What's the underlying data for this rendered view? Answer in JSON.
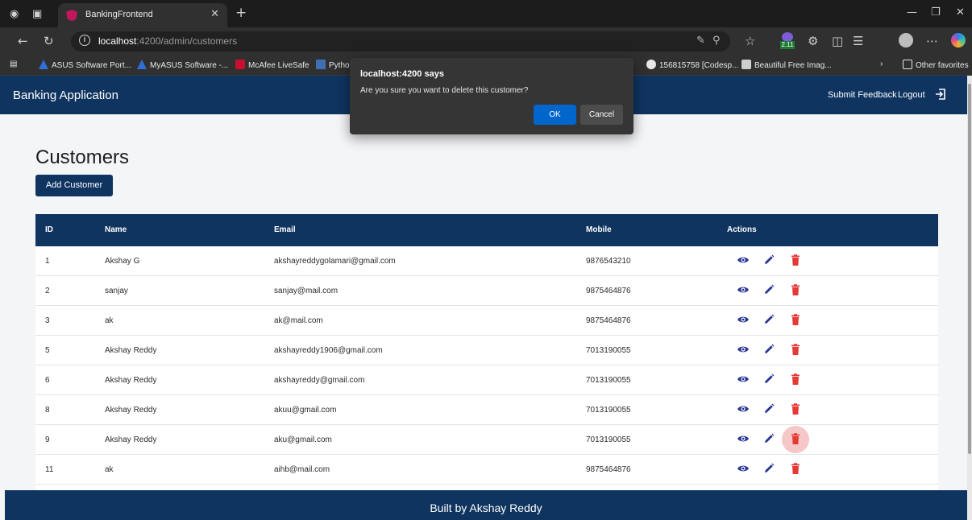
{
  "browser": {
    "tab_title": "BankingFrontend",
    "url_host": "localhost",
    "url_path": ":4200/admin/customers",
    "bookmarks": [
      "ASUS Software Port...",
      "MyASUS Software -...",
      "McAfee LiveSafe",
      "Python",
      "156815758 [Codesp...",
      "Beautiful Free Imag..."
    ],
    "other_favorites": "Other favorites",
    "extension_badge": "2.11"
  },
  "navbar": {
    "brand": "Banking Application",
    "feedback": "Submit Feedback",
    "logout": "Logout"
  },
  "main": {
    "title": "Customers",
    "add_button": "Add Customer"
  },
  "table": {
    "headers": [
      "ID",
      "Name",
      "Email",
      "Mobile",
      "Actions"
    ],
    "rows": [
      {
        "id": "1",
        "name": "Akshay G",
        "email": "akshayreddygolamari@gmail.com",
        "mobile": "9876543210"
      },
      {
        "id": "2",
        "name": "sanjay",
        "email": "sanjay@mail.com",
        "mobile": "9875464876"
      },
      {
        "id": "3",
        "name": "ak",
        "email": "ak@mail.com",
        "mobile": "9875464876"
      },
      {
        "id": "5",
        "name": "Akshay Reddy",
        "email": "akshayreddy1906@gmail.com",
        "mobile": "7013190055"
      },
      {
        "id": "6",
        "name": "Akshay Reddy",
        "email": "akshayreddy@gmail.com",
        "mobile": "7013190055"
      },
      {
        "id": "8",
        "name": "Akshay Reddy",
        "email": "akuu@gmail.com",
        "mobile": "7013190055"
      },
      {
        "id": "9",
        "name": "Akshay Reddy",
        "email": "aku@gmail.com",
        "mobile": "7013190055"
      },
      {
        "id": "11",
        "name": "ak",
        "email": "aihb@mail.com",
        "mobile": "9875464876"
      }
    ]
  },
  "footer": "Built by Akshay Reddy",
  "dialog": {
    "title": "localhost:4200 says",
    "message": "Are you sure you want to delete this customer?",
    "ok": "OK",
    "cancel": "Cancel"
  },
  "colors": {
    "primary": "#0f3460",
    "view_icon": "#283593",
    "edit_icon": "#283593",
    "delete_icon": "#e53935",
    "dialog_ok": "#0066cc"
  }
}
